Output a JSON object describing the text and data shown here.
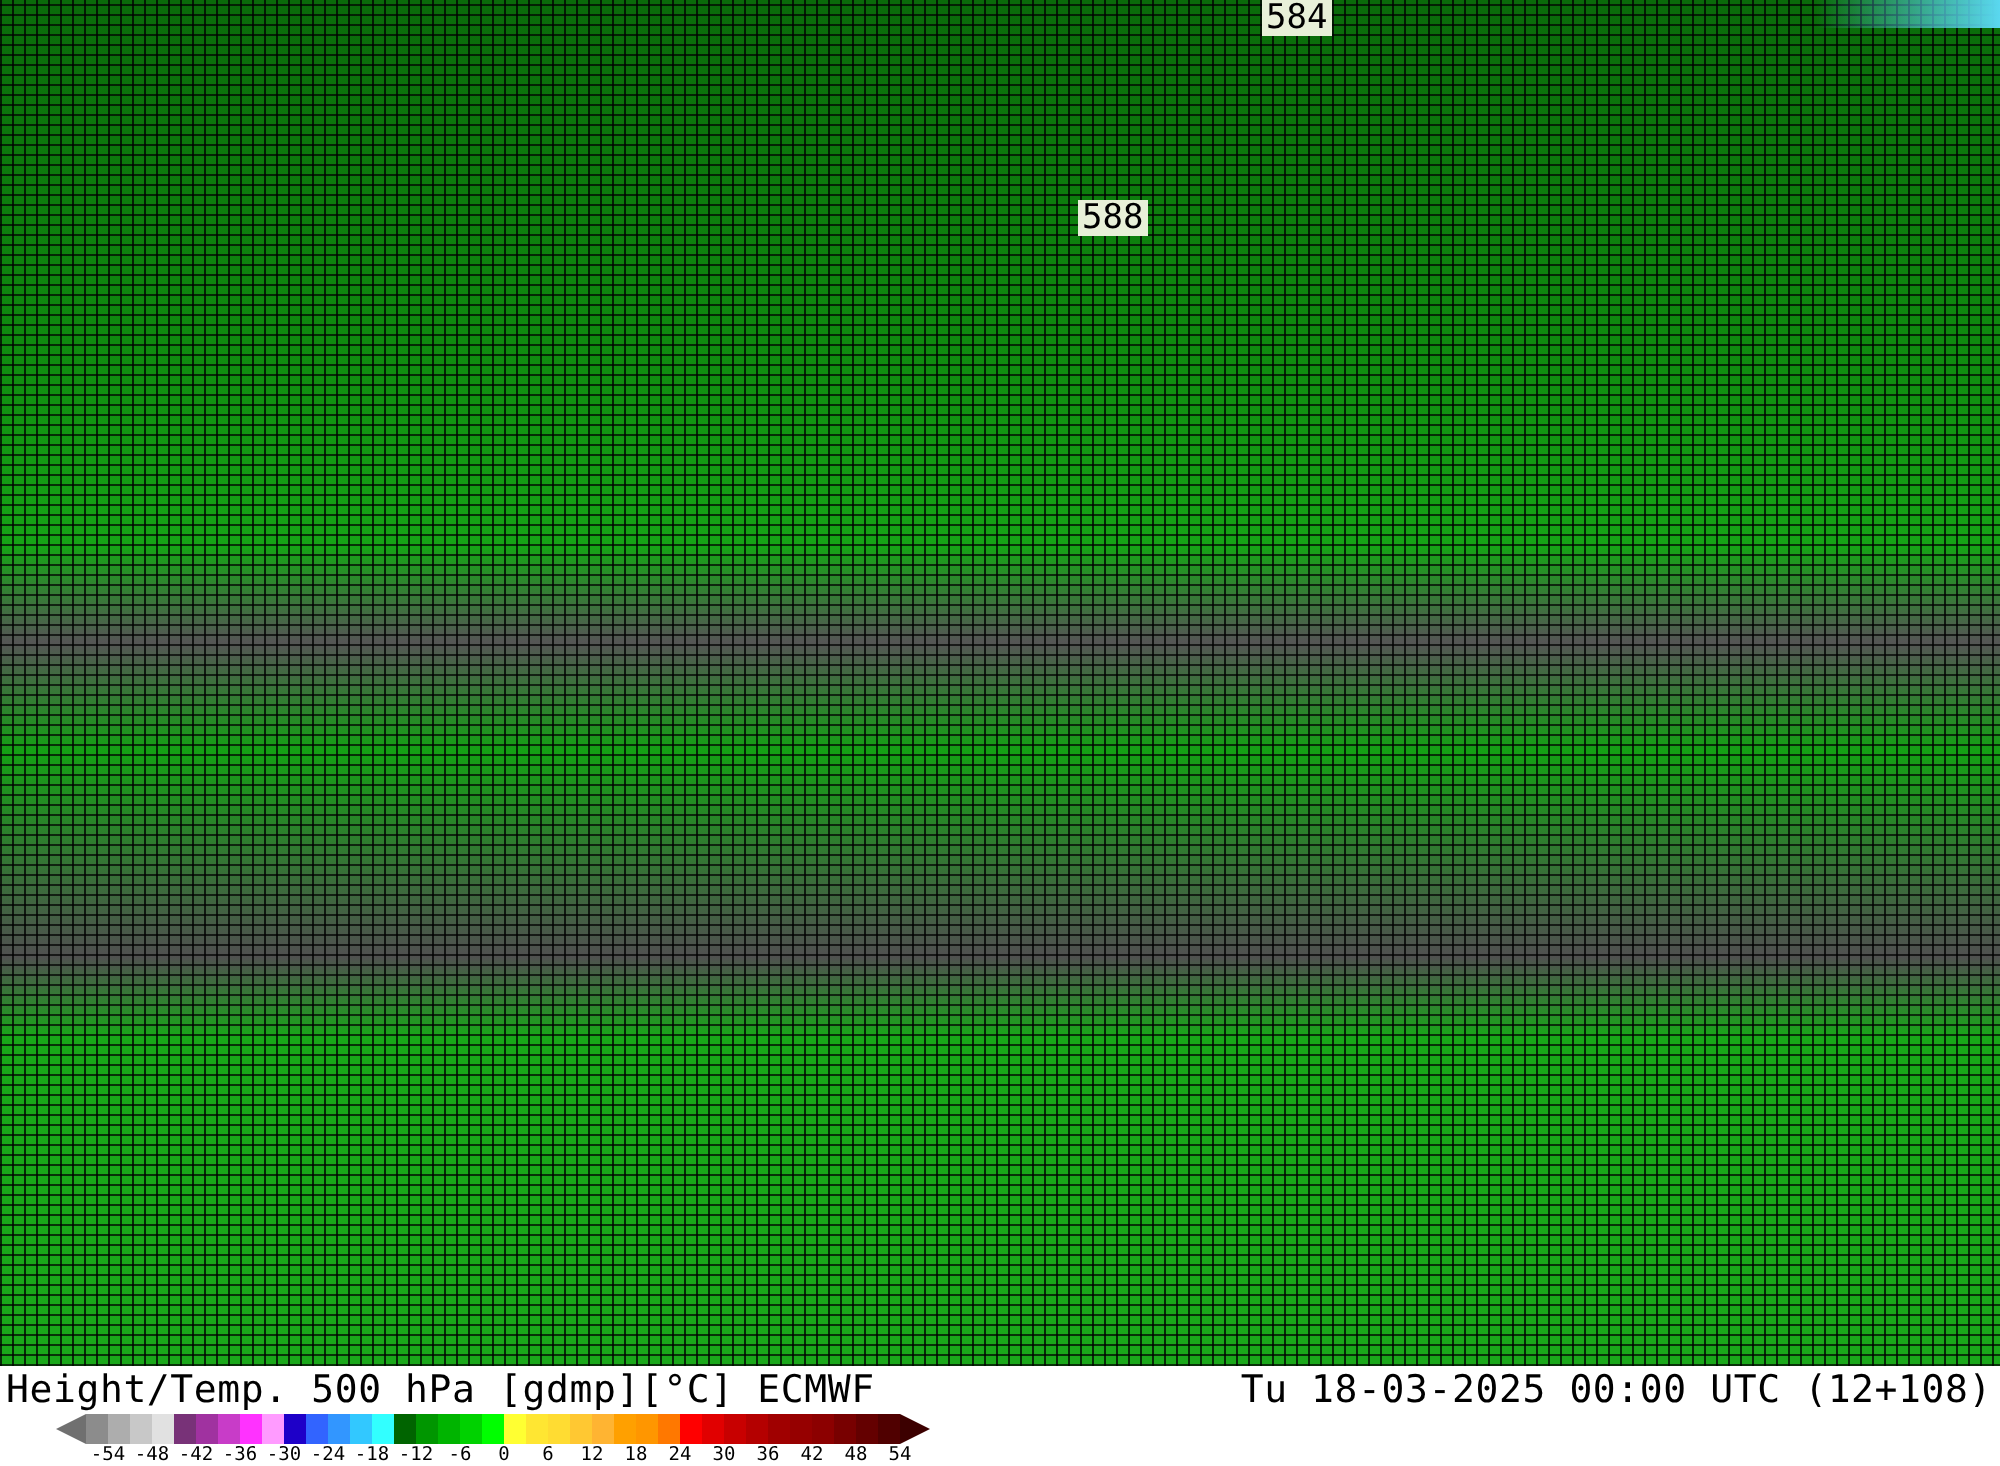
{
  "map": {
    "contour_labels": [
      {
        "text": "584",
        "kind": "top"
      },
      {
        "text": "588",
        "kind": "mid"
      }
    ]
  },
  "title": "Height/Temp. 500 hPa [gdmp][°C] ECMWF",
  "valid_time": "Tu 18-03-2025 00:00 UTC (12+108)",
  "scale": {
    "swatches": [
      {
        "color": "#8c8c8c"
      },
      {
        "color": "#adadad"
      },
      {
        "color": "#c8c8c8"
      },
      {
        "color": "#e1e1e1"
      },
      {
        "color": "#783278"
      },
      {
        "color": "#a032a0"
      },
      {
        "color": "#c83cc8"
      },
      {
        "color": "#ff32ff"
      },
      {
        "color": "#ff9bff"
      },
      {
        "color": "#1e00c8"
      },
      {
        "color": "#3264ff"
      },
      {
        "color": "#3296ff"
      },
      {
        "color": "#32c8ff"
      },
      {
        "color": "#32ffff"
      },
      {
        "color": "#006400"
      },
      {
        "color": "#009600"
      },
      {
        "color": "#00b400"
      },
      {
        "color": "#00d200"
      },
      {
        "color": "#00ff00"
      },
      {
        "color": "#ffff32"
      },
      {
        "color": "#ffe632"
      },
      {
        "color": "#ffdc32"
      },
      {
        "color": "#ffc832"
      },
      {
        "color": "#ffb432"
      },
      {
        "color": "#ffa000"
      },
      {
        "color": "#ff9600"
      },
      {
        "color": "#ff7800"
      },
      {
        "color": "#ff0000"
      },
      {
        "color": "#e10000"
      },
      {
        "color": "#c80000"
      },
      {
        "color": "#b40000"
      },
      {
        "color": "#a00000"
      },
      {
        "color": "#960000"
      },
      {
        "color": "#8c0000"
      },
      {
        "color": "#780000"
      },
      {
        "color": "#640000"
      },
      {
        "color": "#500000"
      }
    ],
    "ticks": [
      "-54",
      "-48",
      "-42",
      "-36",
      "-30",
      "-24",
      "-18",
      "-12",
      "-6",
      "0",
      "6",
      "12",
      "18",
      "24",
      "30",
      "36",
      "42",
      "48",
      "54"
    ]
  }
}
